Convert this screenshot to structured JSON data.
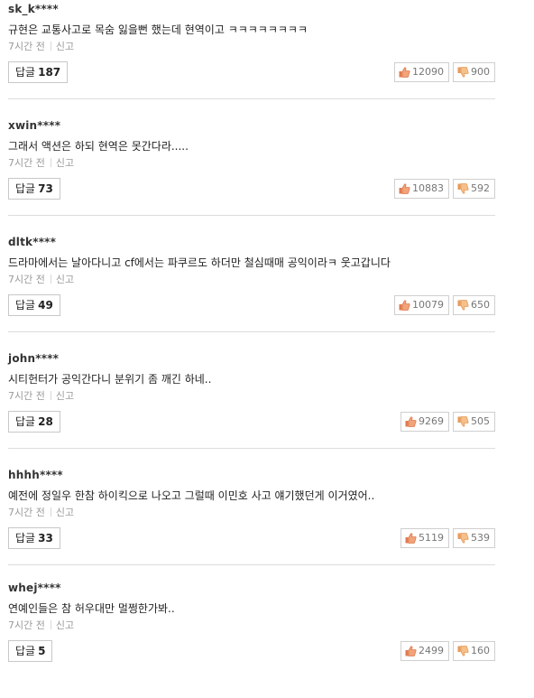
{
  "colors": {
    "thumb_up": "#e07b4f",
    "thumb_down": "#e89a5a",
    "border": "#cfcfcf",
    "divider": "#dcdcdc"
  },
  "icons": {
    "up": "thumbs-up-icon",
    "down": "thumbs-down-icon"
  },
  "comments": [
    {
      "author": "sk_k****",
      "text": "규현은 교통사고로 목숨 잃을뻔 했는데 현역이고 ㅋㅋㅋㅋㅋㅋㅋㅋ",
      "time": "7시간 전",
      "report": "신고",
      "reply_label": "답글",
      "reply_count": "187",
      "likes": "12090",
      "dislikes": "900"
    },
    {
      "author": "xwin****",
      "text": "그래서 액션은 하되 현역은 못간다라.....",
      "time": "7시간 전",
      "report": "신고",
      "reply_label": "답글",
      "reply_count": "73",
      "likes": "10883",
      "dislikes": "592"
    },
    {
      "author": "dltk****",
      "text": "드라마에서는 날아다니고 cf에서는 파쿠르도 하더만 철심때매 공익이라ㅋ 웃고갑니다",
      "time": "7시간 전",
      "report": "신고",
      "reply_label": "답글",
      "reply_count": "49",
      "likes": "10079",
      "dislikes": "650"
    },
    {
      "author": "john****",
      "text": "시티헌터가 공익간다니 분위기 좀 깨긴 하네..",
      "time": "7시간 전",
      "report": "신고",
      "reply_label": "답글",
      "reply_count": "28",
      "likes": "9269",
      "dislikes": "505"
    },
    {
      "author": "hhhh****",
      "text": "예전에 정일우 한참 하이킥으로 나오고 그럴때 이민호 사고 얘기했던게 이거였어..",
      "time": "7시간 전",
      "report": "신고",
      "reply_label": "답글",
      "reply_count": "33",
      "likes": "5119",
      "dislikes": "539"
    },
    {
      "author": "whej****",
      "text": "연예인들은 참 허우대만 멀쩡한가봐..",
      "time": "7시간 전",
      "report": "신고",
      "reply_label": "답글",
      "reply_count": "5",
      "likes": "2499",
      "dislikes": "160"
    }
  ]
}
